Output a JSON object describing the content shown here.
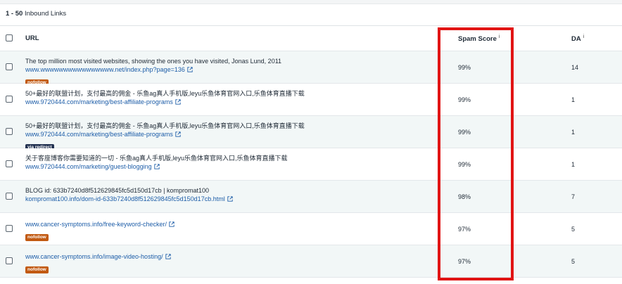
{
  "header": {
    "range": "1 - 50",
    "section_title": "Inbound Links"
  },
  "columns": {
    "url": "URL",
    "spam_score": "Spam Score",
    "spam_info": "i",
    "da": "DA",
    "da_info": "i"
  },
  "rows": [
    {
      "title": "The top million most visited websites, showing the ones you have visited, Jonas Lund, 2011",
      "link": "www.wwwwwwwwwwwwwwww.net/index.php?page=136",
      "badge": "nofollow",
      "spam_score": "99%",
      "da": "14"
    },
    {
      "title": "50+最好的联盟计划，支付最高的佣金 - 乐鱼ag真人手机版,leyu乐鱼体育官网入口,乐鱼体育直播下载",
      "link": "www.9720444.com/marketing/best-affiliate-programs",
      "badge": "",
      "spam_score": "99%",
      "da": "1"
    },
    {
      "title": "50+最好的联盟计划，支付最高的佣金 - 乐鱼ag真人手机版,leyu乐鱼体育官网入口,乐鱼体育直播下载",
      "link": "www.9720444.com/marketing/best-affiliate-programs",
      "badge": "via redirect",
      "spam_score": "99%",
      "da": "1"
    },
    {
      "title": "关于客座博客你需要知道的一切 - 乐鱼ag真人手机版,leyu乐鱼体育官网入口,乐鱼体育直播下载",
      "link": "www.9720444.com/marketing/guest-blogging",
      "badge": "",
      "spam_score": "99%",
      "da": "1"
    },
    {
      "title": "BLOG id: 633b7240d8f512629845fc5d150d17cb | kompromat100",
      "link": "kompromat100.info/dom-id-633b7240d8f512629845fc5d150d17cb.html",
      "badge": "",
      "spam_score": "98%",
      "da": "7"
    },
    {
      "title": "",
      "link": "www.cancer-symptoms.info/free-keyword-checker/",
      "badge": "nofollow",
      "spam_score": "97%",
      "da": "5"
    },
    {
      "title": "",
      "link": "www.cancer-symptoms.info/image-video-hosting/",
      "badge": "nofollow",
      "spam_score": "97%",
      "da": "5"
    }
  ],
  "icons": {
    "checkbox": "checkbox-icon",
    "external_link": "external-link-icon"
  },
  "colors": {
    "link": "#1d5da8",
    "nofollow_badge": "#c25a12",
    "redirect_badge": "#243352",
    "row_tint": "#f2f7f7",
    "highlight": "#e11414"
  }
}
